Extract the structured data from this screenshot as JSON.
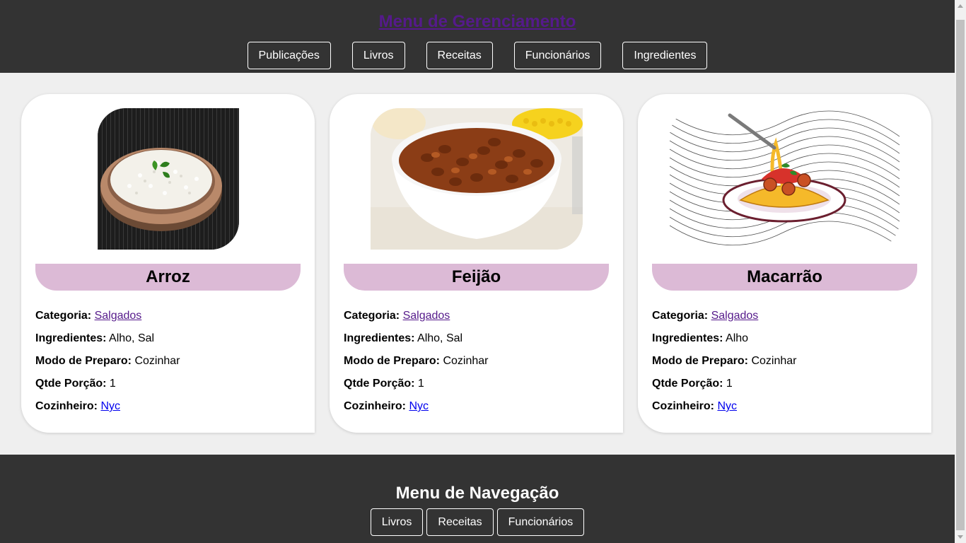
{
  "header": {
    "title": "Menu de Gerenciamento",
    "nav": [
      "Publicações",
      "Livros",
      "Receitas",
      "Funcionários",
      "Ingredientes"
    ]
  },
  "labels": {
    "categoria": "Categoria:",
    "ingredientes": "Ingredientes:",
    "modo_preparo": "Modo de Preparo:",
    "qtde_porcao": "Qtde Porção:",
    "cozinheiro": "Cozinheiro:"
  },
  "recipes": [
    {
      "name": "Arroz",
      "image": "rice-bowl-photo",
      "categoria": "Salgados",
      "ingredientes": "Alho, Sal",
      "modo_preparo": "Cozinhar",
      "qtde_porcao": "1",
      "cozinheiro": "Nyc"
    },
    {
      "name": "Feijão",
      "image": "beans-bowl-photo",
      "categoria": "Salgados",
      "ingredientes": "Alho, Sal",
      "modo_preparo": "Cozinhar",
      "qtde_porcao": "1",
      "cozinheiro": "Nyc"
    },
    {
      "name": "Macarrão",
      "image": "spaghetti-illustration",
      "categoria": "Salgados",
      "ingredientes": "Alho",
      "modo_preparo": "Cozinhar",
      "qtde_porcao": "1",
      "cozinheiro": "Nyc"
    }
  ],
  "footer": {
    "title": "Menu de Navegação",
    "nav": [
      "Livros",
      "Receitas",
      "Funcionários"
    ]
  },
  "colors": {
    "header_bg": "#333333",
    "page_bg": "#efefef",
    "title_band": "#dcbad6",
    "visited_link": "#551a8b",
    "link": "#0000ee"
  }
}
